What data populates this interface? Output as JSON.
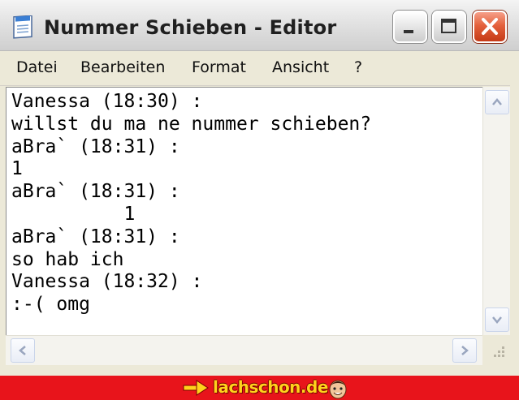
{
  "window": {
    "title": "Nummer Schieben - Editor",
    "app_icon": "notepad-icon",
    "controls": [
      "minimize-icon",
      "maximize-icon",
      "close-icon"
    ]
  },
  "menu": {
    "items": [
      {
        "label": "Datei"
      },
      {
        "label": "Bearbeiten"
      },
      {
        "label": "Format"
      },
      {
        "label": "Ansicht"
      },
      {
        "label": "?"
      }
    ]
  },
  "document": {
    "text": "Vanessa (18:30) :\nwillst du ma ne nummer schieben?\naBra` (18:31) :\n1\naBra` (18:31) :\n          1\naBra` (18:31) :\nso hab ich\nVanessa (18:32) :\n:-( omg"
  },
  "scrollbars": {
    "icons": [
      "scroll-up-icon",
      "scroll-down-icon",
      "scroll-left-icon",
      "scroll-right-icon",
      "size-grip-icon"
    ]
  },
  "banner": {
    "logo_text": "lachschon.de",
    "icons": [
      "arrow-right-icon",
      "smiley-face-icon"
    ],
    "background_color": "#e8141b",
    "logo_color": "#ffd21c"
  }
}
